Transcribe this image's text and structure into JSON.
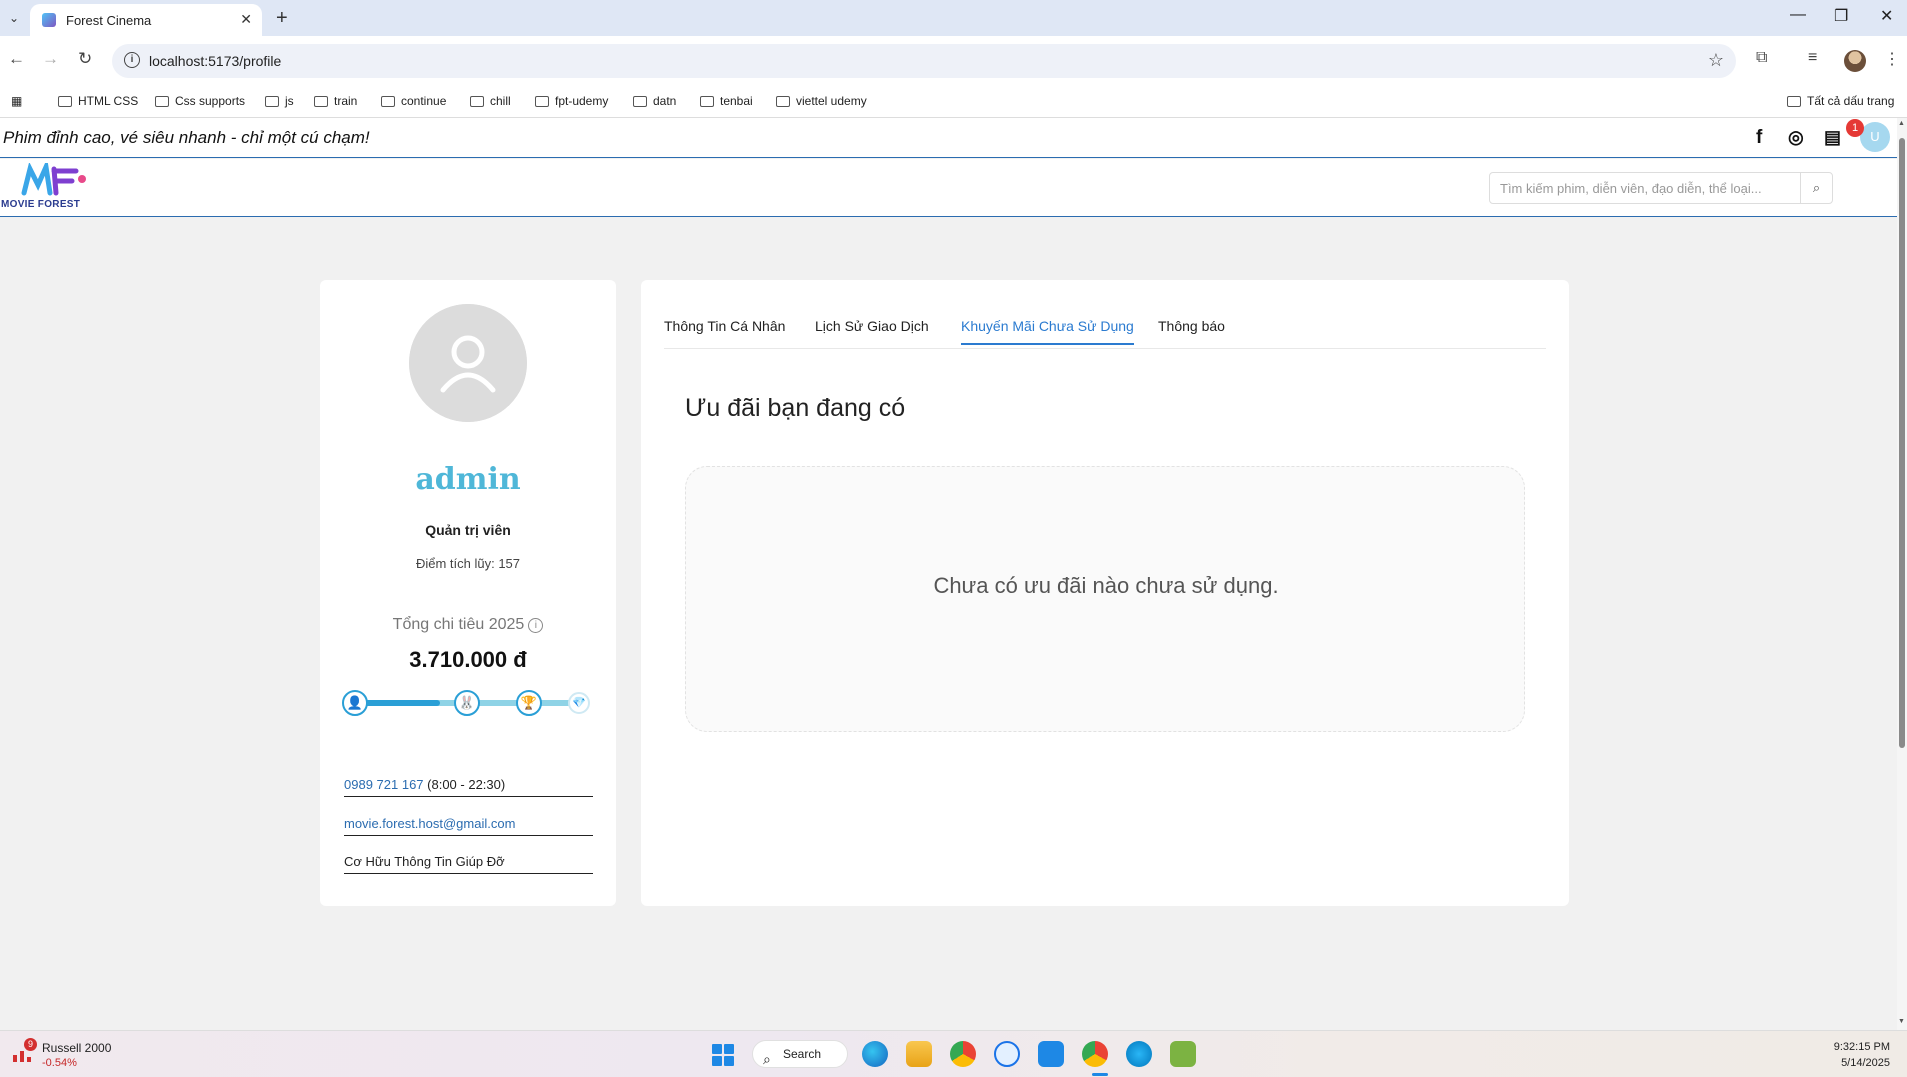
{
  "browser": {
    "tab_title": "Forest Cinema",
    "url": "localhost:5173/profile",
    "bookmarks": [
      "HTML CSS",
      "Css supports",
      "js",
      "train",
      "continue",
      "chill",
      "fpt-udemy",
      "datn",
      "tenbai",
      "viettel udemy"
    ],
    "all_bookmarks": "Tất cả dấu trang"
  },
  "site": {
    "slogan": "Phim đỉnh cao, vé siêu nhanh - chỉ một cú chạm!",
    "logo_text": "MOVIE FOREST",
    "notification_count": "1",
    "user_initial": "U",
    "search_placeholder": "Tìm kiếm phim, diễn viên, đạo diễn, thể loại..."
  },
  "profile": {
    "username": "admin",
    "role": "Quản trị viên",
    "points": "Điểm tích lũy: 157",
    "spend_label": "Tổng chi tiêu 2025",
    "spend_amount": "3.710.000 đ",
    "spend_progress": 0.37,
    "phone": "0989 721 167",
    "hours": "(8:00 - 22:30)",
    "email": "movie.forest.host@gmail.com",
    "help": "Cơ Hữu Thông Tin Giúp Đỡ"
  },
  "tabs": [
    "Thông Tin Cá Nhân",
    "Lịch Sử Giao Dịch",
    "Khuyến Mãi Chưa Sử Dụng",
    "Thông báo"
  ],
  "active_tab": 2,
  "promotions": {
    "title": "Ưu đãi bạn đang có",
    "empty_message": "Chưa có ưu đãi nào chưa sử dụng."
  },
  "taskbar": {
    "stock_name": "Russell 2000",
    "stock_change": "-0.54%",
    "stock_badge": "9",
    "search_label": "Search",
    "time": "9:32:15 PM",
    "date": "5/14/2025"
  }
}
